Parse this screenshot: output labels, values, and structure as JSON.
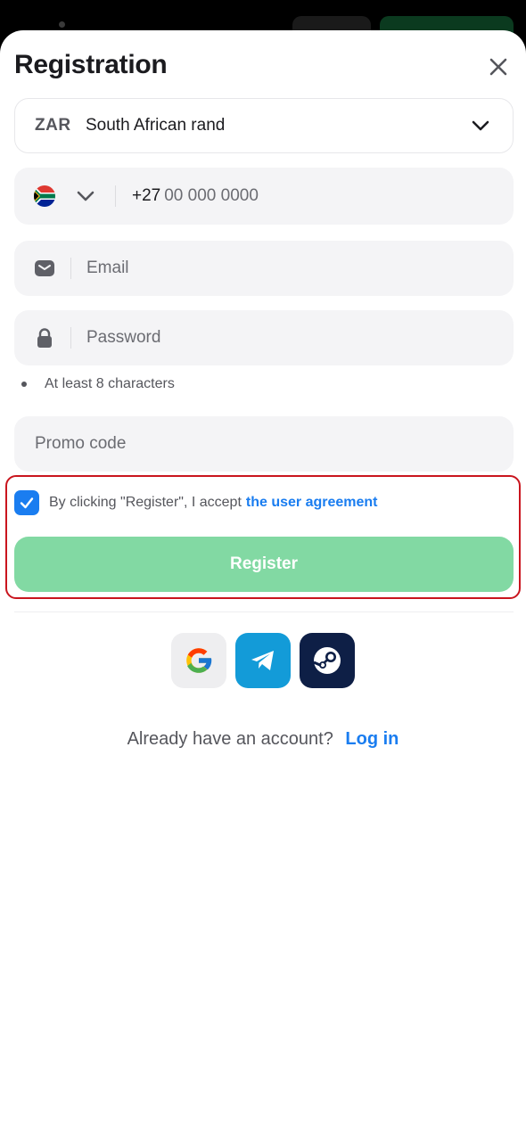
{
  "dialog": {
    "title": "Registration"
  },
  "currency": {
    "code": "ZAR",
    "name": "South African rand"
  },
  "phone": {
    "country_code": "+27",
    "placeholder": "00 000 0000"
  },
  "email": {
    "placeholder": "Email"
  },
  "password": {
    "placeholder": "Password",
    "hint": "At least 8 characters"
  },
  "promo": {
    "placeholder": "Promo code"
  },
  "agreement": {
    "checked": true,
    "text": "By clicking \"Register\", I accept",
    "link": "the user agreement"
  },
  "register": {
    "label": "Register",
    "color": "#82d9a3"
  },
  "social": [
    "google",
    "telegram",
    "steam"
  ],
  "footer": {
    "question": "Already have an account?",
    "login_link": "Log in"
  },
  "colors": {
    "accent": "#1a7df0",
    "highlight_border": "#c9151e",
    "telegram": "#139bd8",
    "steam": "#0e1f46"
  }
}
